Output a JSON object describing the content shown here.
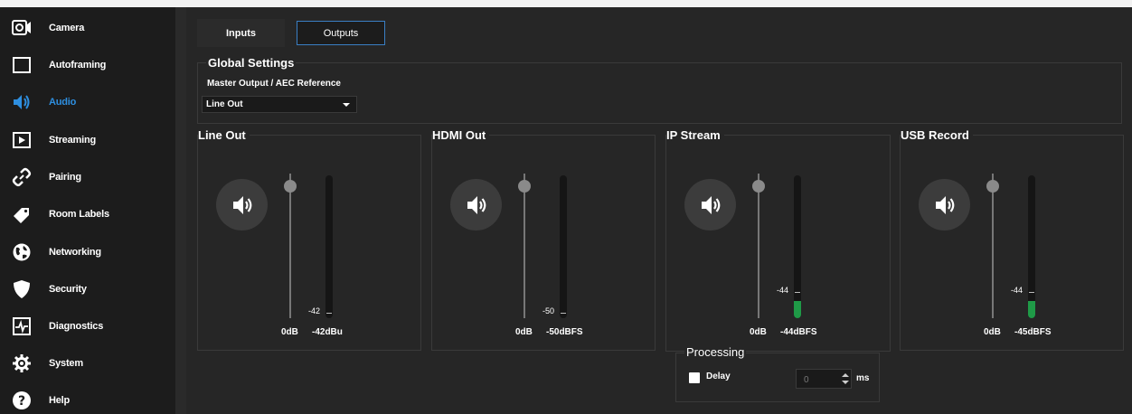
{
  "sidebar": {
    "items": [
      {
        "label": "Camera",
        "icon": "camera-icon"
      },
      {
        "label": "Autoframing",
        "icon": "frame-icon"
      },
      {
        "label": "Audio",
        "icon": "speaker-icon",
        "active": true
      },
      {
        "label": "Streaming",
        "icon": "play-icon"
      },
      {
        "label": "Pairing",
        "icon": "link-icon"
      },
      {
        "label": "Room Labels",
        "icon": "tag-icon"
      },
      {
        "label": "Networking",
        "icon": "globe-icon"
      },
      {
        "label": "Security",
        "icon": "shield-icon"
      },
      {
        "label": "Diagnostics",
        "icon": "pulse-icon"
      },
      {
        "label": "System",
        "icon": "gear-icon"
      },
      {
        "label": "Help",
        "icon": "question-icon"
      }
    ]
  },
  "tabs": {
    "inputs": "Inputs",
    "outputs": "Outputs"
  },
  "global": {
    "title": "Global Settings",
    "subtitle": "Master Output / AEC Reference",
    "selected": "Line Out"
  },
  "panels": [
    {
      "title": "Line Out",
      "meter_value": "-42",
      "meter_level": 0.0,
      "gain": "0dB",
      "level": "-42dBu"
    },
    {
      "title": "HDMI Out",
      "meter_value": "-50",
      "meter_level": 0.0,
      "gain": "0dB",
      "level": "-50dBFS"
    },
    {
      "title": "IP Stream",
      "meter_value": "-44",
      "meter_level": 0.12,
      "gain": "0dB",
      "level": "-44dBFS"
    },
    {
      "title": "USB Record",
      "meter_value": "-44",
      "meter_level": 0.12,
      "gain": "0dB",
      "level": "-45dBFS"
    }
  ],
  "processing": {
    "title": "Processing",
    "delay_label": "Delay",
    "delay_value": "0",
    "unit": "ms"
  },
  "colors": {
    "accent": "#2e8fe0",
    "meter_green": "#1f9a47"
  }
}
